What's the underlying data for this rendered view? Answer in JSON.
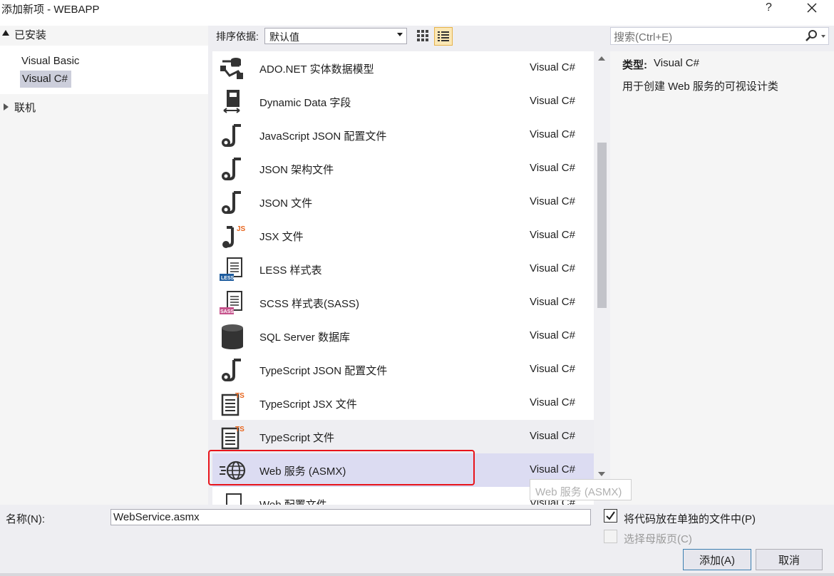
{
  "window": {
    "title": "添加新项 - WEBAPP",
    "help": "?",
    "close": "✕"
  },
  "tree": {
    "installed": "已安装",
    "languages": [
      "Visual Basic",
      "Visual C#"
    ],
    "online": "联机"
  },
  "toolbar": {
    "sort_label": "排序依据:",
    "sort_value": "默认值"
  },
  "search": {
    "placeholder": "搜索(Ctrl+E)"
  },
  "templates": [
    {
      "name": "ADO.NET 实体数据模型",
      "lang": "Visual C#",
      "icon": "ado-entity-model-icon"
    },
    {
      "name": "Dynamic Data 字段",
      "lang": "Visual C#",
      "icon": "dynamic-data-field-icon"
    },
    {
      "name": "JavaScript JSON 配置文件",
      "lang": "Visual C#",
      "icon": "json-file-icon"
    },
    {
      "name": "JSON 架构文件",
      "lang": "Visual C#",
      "icon": "json-file-icon"
    },
    {
      "name": "JSON 文件",
      "lang": "Visual C#",
      "icon": "json-file-icon"
    },
    {
      "name": "JSX 文件",
      "lang": "Visual C#",
      "icon": "jsx-file-icon"
    },
    {
      "name": "LESS 样式表",
      "lang": "Visual C#",
      "icon": "less-stylesheet-icon"
    },
    {
      "name": "SCSS 样式表(SASS)",
      "lang": "Visual C#",
      "icon": "scss-stylesheet-icon"
    },
    {
      "name": "SQL Server 数据库",
      "lang": "Visual C#",
      "icon": "database-icon"
    },
    {
      "name": "TypeScript JSON 配置文件",
      "lang": "Visual C#",
      "icon": "json-file-icon"
    },
    {
      "name": "TypeScript JSX 文件",
      "lang": "Visual C#",
      "icon": "typescript-file-icon"
    },
    {
      "name": "TypeScript 文件",
      "lang": "Visual C#",
      "icon": "typescript-file-icon"
    },
    {
      "name": "Web 服务 (ASMX)",
      "lang": "Visual C#",
      "icon": "globe-icon"
    },
    {
      "name": "Web 配置文件",
      "lang": "Visual C#",
      "icon": "web-config-icon"
    }
  ],
  "tooltip": "Web 服务 (ASMX)",
  "detail": {
    "type_label": "类型:",
    "type_value": "Visual C#",
    "description": "用于创建 Web 服务的可视设计类"
  },
  "form": {
    "name_label": "名称(N):",
    "name_value": "WebService.asmx",
    "separate_file_label": "将代码放在单独的文件中(P)",
    "master_page_label": "选择母版页(C)",
    "add_label": "添加(A)",
    "cancel_label": "取消"
  },
  "colors": {
    "selection_outline": "#e8141b",
    "selected_row": "#dcdcf2",
    "hover_row": "#eeeef2",
    "accent_button": "#3c7fb1"
  }
}
